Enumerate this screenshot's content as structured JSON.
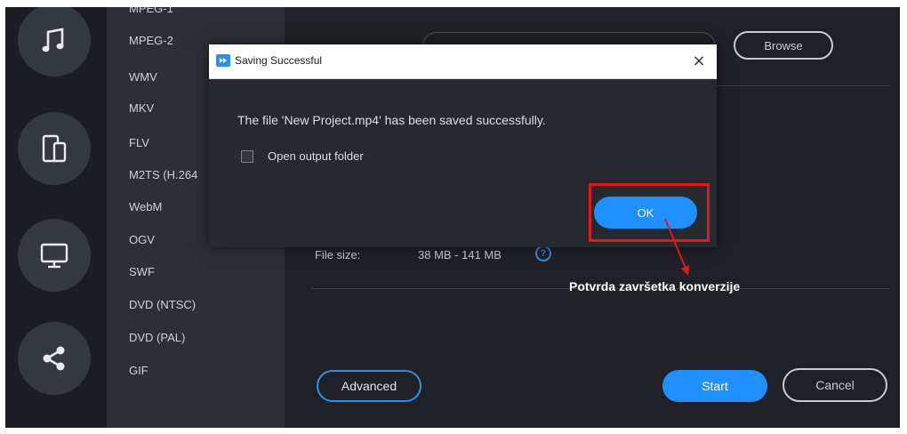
{
  "app": {
    "sidebar_icons": [
      "music-note-icon",
      "devices-icon",
      "monitor-icon",
      "share-icon"
    ],
    "formats": [
      "MPEG-1",
      "MPEG-2",
      "WMV",
      "MKV",
      "FLV",
      "M2TS (H.264",
      "WebM",
      "OGV",
      "SWF",
      "DVD (NTSC)",
      "DVD (PAL)",
      "GIF"
    ]
  },
  "output": {
    "browse_label": "Browse",
    "file_size_label": "File size:",
    "file_size_value": "38 MB - 141 MB",
    "help_glyph": "?"
  },
  "footer": {
    "advanced_label": "Advanced",
    "start_label": "Start",
    "cancel_label": "Cancel"
  },
  "dialog": {
    "title": "Saving Successful",
    "close_glyph": "×",
    "message": "The file 'New Project.mp4' has been saved successfully.",
    "checkbox_label": "Open output folder",
    "checkbox_checked": false,
    "ok_label": "OK"
  },
  "annotation": {
    "text": "Potvrda završetka konverzije",
    "color": "#e01818"
  },
  "colors": {
    "accent": "#1e90ff",
    "background": "#1f2126",
    "highlight": "#e01818"
  }
}
